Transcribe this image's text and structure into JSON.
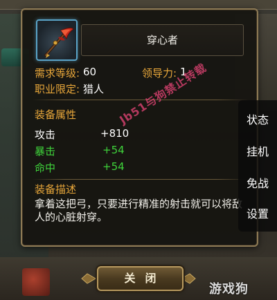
{
  "item": {
    "name": "穿心者",
    "icon": "red-bow-icon"
  },
  "requirements": {
    "level_label": "需求等级:",
    "level_value": "60",
    "leadership_label": "领导力:",
    "leadership_value": "1",
    "class_label": "职业限定:",
    "class_value": "猎人"
  },
  "attributes": {
    "title": "装备属性",
    "rows": [
      {
        "label": "攻击",
        "value": "+810",
        "color": "#ffffff"
      },
      {
        "label": "暴击",
        "value": "+54",
        "color": "#3fd43b"
      },
      {
        "label": "命中",
        "value": "+54",
        "color": "#3fd43b"
      }
    ]
  },
  "description": {
    "title": "装备描述",
    "text": "拿着这把弓，只要进行精准的射击就可以将敌人的心脏射穿。"
  },
  "side_menu": [
    "状态",
    "挂机",
    "免战",
    "设置"
  ],
  "close_button": "关闭",
  "watermark": "Jb51与狗禁止转载",
  "logo": "游戏狗",
  "colors": {
    "gold_label": "#e8a73a",
    "green_value": "#3fd43b",
    "icon_frame": "#5aa4c8",
    "panel_border": "#8d7a55"
  }
}
